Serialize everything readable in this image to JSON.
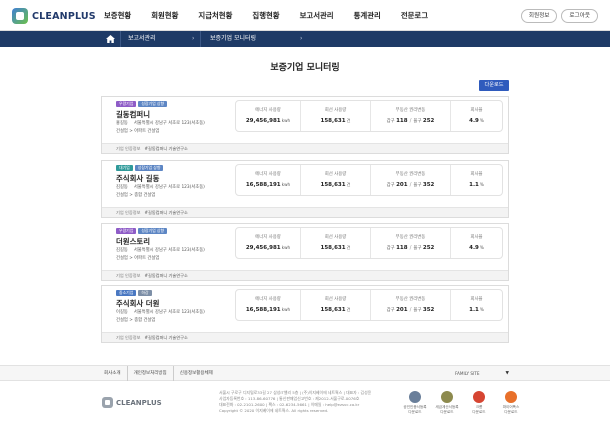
{
  "header": {
    "logo": "CLEANPLUS",
    "nav": [
      "보증현황",
      "회원현황",
      "지급처현황",
      "집행현황",
      "보고서관리",
      "통계관리",
      "전문로그"
    ],
    "buttons": [
      "회원정보",
      "로그아웃"
    ]
  },
  "breadcrumb": {
    "level1": "보고서관리",
    "level2": "보증기업 모니터링"
  },
  "page": {
    "title": "보증기업 모니터링",
    "download": "다운로드"
  },
  "stat_labels": {
    "energy": "에너지 사용량",
    "recovery": "회선 사용량",
    "realestate": "부동산 권리변동",
    "rate": "회사율"
  },
  "realestate_keys": {
    "a": "갑구",
    "b": "을구"
  },
  "cards": [
    {
      "tags": [
        {
          "text": "우량기업",
          "color": "#8e5cc7"
        },
        {
          "text": "성장기업 상향",
          "color": "#5d86c4"
        }
      ],
      "name": "길동컴퍼니",
      "ceo": "홍길동",
      "address": "서울특별시 강남구 서초로 123(서초동)",
      "industry": "건설업 > 아파트 건설업",
      "energy": "29,456,981",
      "energy_unit": "kwh",
      "recovery": "158,631",
      "recovery_unit": "건",
      "re_a": "118",
      "re_b": "252",
      "rate": "4.9",
      "rate_unit": "%",
      "foot_label": "기업 인증정보",
      "foot_value": "#길동컴퍼니 기술연구소"
    },
    {
      "tags": [
        {
          "text": "대기업",
          "color": "#2f9a9a"
        },
        {
          "text": "성장기업 상향",
          "color": "#5d86c4"
        }
      ],
      "name": "주식회사 길동",
      "ceo": "김길동",
      "address": "서울특별시 강남구 서초로 123(서초동)",
      "industry": "건설업 > 종합 건설업",
      "energy": "16,588,191",
      "energy_unit": "kwh",
      "recovery": "158,631",
      "recovery_unit": "건",
      "re_a": "201",
      "re_b": "352",
      "rate": "1.1",
      "rate_unit": "%",
      "foot_label": "기업 인증정보",
      "foot_value": "#길동컴퍼니 기술연구소"
    },
    {
      "tags": [
        {
          "text": "우량기업",
          "color": "#8e5cc7"
        },
        {
          "text": "성장기업 상향",
          "color": "#5d86c4"
        }
      ],
      "name": "더원스토리",
      "ceo": "김길동",
      "address": "서울특별시 강남구 서초로 123(서초동)",
      "industry": "건설업 > 아파트 건설업",
      "energy": "29,456,981",
      "energy_unit": "kwh",
      "recovery": "158,631",
      "recovery_unit": "건",
      "re_a": "118",
      "re_b": "252",
      "rate": "4.9",
      "rate_unit": "%",
      "foot_label": "기업 인증정보",
      "foot_value": "#길동컴퍼니 기술연구소"
    },
    {
      "tags": [
        {
          "text": "중소기업",
          "color": "#4a78c2"
        },
        {
          "text": "하강",
          "color": "#7d8fa7"
        }
      ],
      "name": "주식회사 더원",
      "ceo": "이길동",
      "address": "서울특별시 강남구 서초로 123(서초동)",
      "industry": "건설업 > 종합 건설업",
      "energy": "16,588,191",
      "energy_unit": "kwh",
      "recovery": "158,631",
      "recovery_unit": "건",
      "re_a": "201",
      "re_b": "352",
      "rate": "1.1",
      "rate_unit": "%",
      "foot_label": "기업 인증정보",
      "foot_value": "#길동컴퍼니 기술연구소"
    }
  ],
  "footer": {
    "links": [
      "회사소개",
      "개인정보처리방침",
      "신용정보활용체제"
    ],
    "family_site": "FAMILY SITE",
    "logo": "CLEANPLUS",
    "address_lines": [
      "서울시 구로구 디지털로33길 27 삼성IT밸리 5층 | (주)이지베이에 네트웍스 | 대표자 : 김성윤",
      "사업자등록번호 : 113-86-60776 | 통신판매업신고번호 : 제2012-서울구로-0076호",
      "대표전화 : 02-2101-2600 | 팩스 : 02-6234-5661 | 이메일 : help@ezsvc.co.kr",
      "Copyright © 2020 이지베이에 네트웍스. All rights reserved."
    ],
    "badges": [
      {
        "line1": "공인인증서등록",
        "line2": "다운로드",
        "color": "#6a7f9a"
      },
      {
        "line1": "세금계산서등록",
        "line2": "다운로드",
        "color": "#8d8a4e"
      },
      {
        "line1": "크롬",
        "line2": "다운로드",
        "color": "#d64532"
      },
      {
        "line1": "파이어폭스",
        "line2": "다운로드",
        "color": "#e8702a"
      }
    ]
  }
}
